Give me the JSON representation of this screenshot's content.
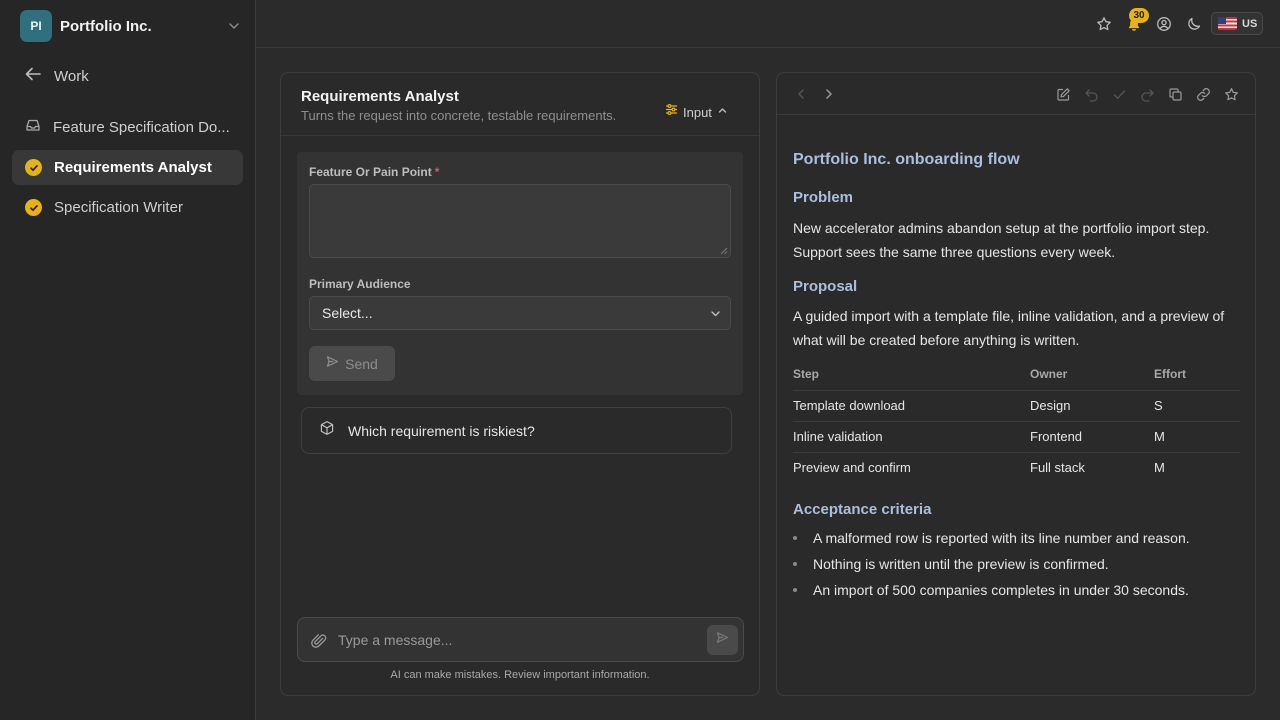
{
  "sidebar": {
    "org_initials": "PI",
    "org_name": "Portfolio Inc.",
    "back_label": "Work",
    "items": [
      {
        "label": "Feature Specification Do..."
      },
      {
        "label": "Requirements Analyst"
      },
      {
        "label": "Specification Writer"
      }
    ]
  },
  "topbar": {
    "notification_count": "30",
    "locale": "US"
  },
  "agent": {
    "title": "Requirements Analyst",
    "subtitle": "Turns the request into concrete, testable requirements.",
    "input_toggle": "Input"
  },
  "form": {
    "field1_label": "Feature Or Pain Point",
    "field1_required": "*",
    "field1_value": "",
    "field2_label": "Primary Audience",
    "field2_value": "Select...",
    "send_label": "Send"
  },
  "suggestion": "Which requirement is riskiest?",
  "composer": {
    "placeholder": "Type a message...",
    "disclaimer": "AI can make mistakes. Review important information."
  },
  "doc": {
    "title": "Portfolio Inc. onboarding flow",
    "problem_heading": "Problem",
    "problem_text": "New accelerator admins abandon setup at the portfolio import step. Support sees the same three questions every week.",
    "proposal_heading": "Proposal",
    "proposal_text": "A guided import with a template file, inline validation, and a preview of what will be created before anything is written.",
    "table": {
      "headers": [
        "Step",
        "Owner",
        "Effort"
      ],
      "rows": [
        [
          "Template download",
          "Design",
          "S"
        ],
        [
          "Inline validation",
          "Frontend",
          "M"
        ],
        [
          "Preview and confirm",
          "Full stack",
          "M"
        ]
      ]
    },
    "criteria_heading": "Acceptance criteria",
    "criteria": [
      "A malformed row is reported with its line number and reason.",
      "Nothing is written until the preview is confirmed.",
      "An import of 500 companies completes in under 30 seconds."
    ]
  },
  "colors": {
    "accent": "#e6b313",
    "heading": "#a9bfdc",
    "background": "#2b2b2b",
    "org_avatar": "#2f6f7e"
  },
  "icons": [
    "chevron-down-icon",
    "arrow-left-icon",
    "inbox-icon",
    "check-circle-icon",
    "star-icon",
    "bell-icon",
    "user-circle-icon",
    "moon-icon",
    "us-flag-icon",
    "sliders-icon",
    "chevron-up-icon",
    "send-icon",
    "cube-icon",
    "paperclip-icon",
    "chevron-left-icon",
    "chevron-right-icon",
    "edit-icon",
    "undo-icon",
    "check-icon",
    "redo-icon",
    "copy-icon",
    "link-icon"
  ]
}
